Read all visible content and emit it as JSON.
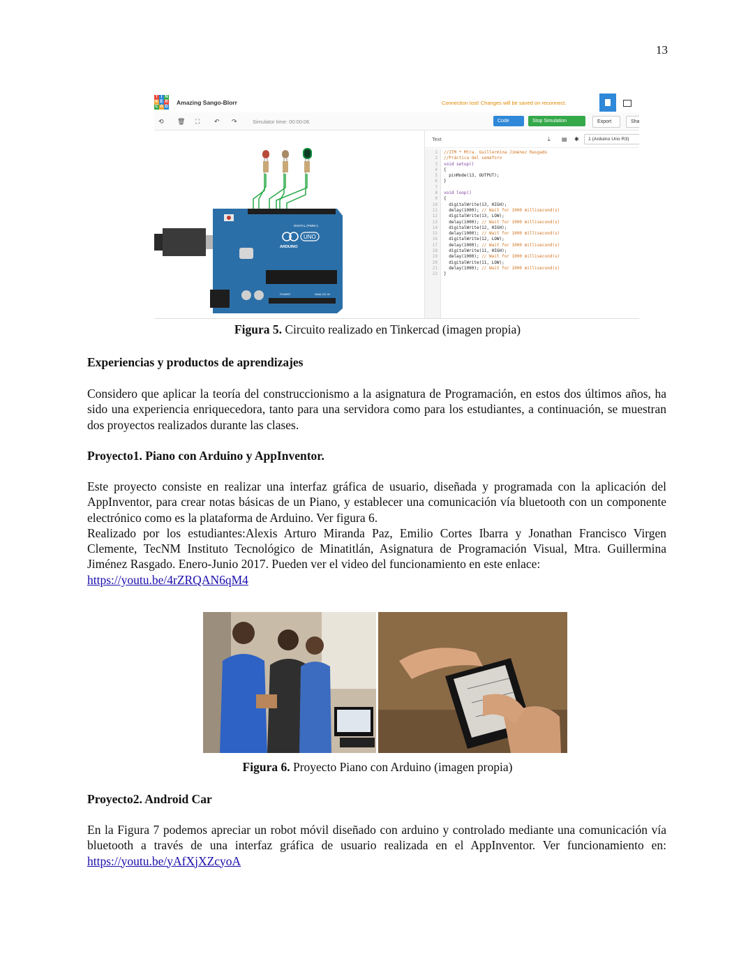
{
  "page_number": "13",
  "figure5": {
    "app_title": "Amazing Sango-Blorr",
    "logo_letters": [
      "T",
      "I",
      "N",
      "K",
      "E",
      "R",
      "C",
      "A",
      "D"
    ],
    "warning": "Connection lost! Changes will be saved on reconnect.",
    "simulator_time": "Simulator time: 00:00:06",
    "buttons": {
      "code": "Code",
      "stop": "Stop Simulation",
      "export": "Export",
      "share": "Sha"
    },
    "panel_label": "Text",
    "board_select": "1 (Arduino Uno R3)",
    "board_labels": {
      "brand": "ARDUINO",
      "model": "UNO",
      "digital": "DIGITAL (PWM~)",
      "power": "POWER",
      "analog": "ANALOG IN"
    },
    "code_lines": [
      {
        "n": "1",
        "t": "//ITM * Mtra. Guillermina Jiménez Rasgado",
        "k": "com"
      },
      {
        "n": "2",
        "t": "//Práctica del semáforo",
        "k": "com"
      },
      {
        "n": "3",
        "t": "void setup()",
        "k": "kw"
      },
      {
        "n": "4",
        "t": "{",
        "k": "txt"
      },
      {
        "n": "5",
        "t": "  pinMode(13, OUTPUT);",
        "k": "txt"
      },
      {
        "n": "6",
        "t": "}",
        "k": "txt"
      },
      {
        "n": "7",
        "t": "",
        "k": "txt"
      },
      {
        "n": "8",
        "t": "void loop()",
        "k": "kw"
      },
      {
        "n": "9",
        "t": "{",
        "k": "txt"
      },
      {
        "n": "10",
        "t": "  digitalWrite(13, HIGH);",
        "k": "txt"
      },
      {
        "n": "11",
        "t": "  delay(1000); // Wait for 1000 millisecond(s)",
        "k": "mix"
      },
      {
        "n": "12",
        "t": "  digitalWrite(13, LOW);",
        "k": "txt"
      },
      {
        "n": "13",
        "t": "  delay(1000); // Wait for 1000 millisecond(s)",
        "k": "mix"
      },
      {
        "n": "14",
        "t": "  digitalWrite(12, HIGH);",
        "k": "txt"
      },
      {
        "n": "15",
        "t": "  delay(1000); // Wait for 1000 millisecond(s)",
        "k": "mix"
      },
      {
        "n": "16",
        "t": "  digitalWrite(12, LOW);",
        "k": "txt"
      },
      {
        "n": "17",
        "t": "  delay(1000); // Wait for 1000 millisecond(s)",
        "k": "mix"
      },
      {
        "n": "18",
        "t": "  digitalWrite(11, HIGH);",
        "k": "txt"
      },
      {
        "n": "19",
        "t": "  delay(1000); // Wait for 1000 millisecond(s)",
        "k": "mix"
      },
      {
        "n": "20",
        "t": "  digitalWrite(11, LOW);",
        "k": "txt"
      },
      {
        "n": "21",
        "t": "  delay(1000); // Wait for 1000 millisecond(s)",
        "k": "mix"
      },
      {
        "n": "22",
        "t": "}",
        "k": "txt"
      }
    ],
    "caption_bold": "Figura 5.",
    "caption_text": " Circuito realizado en Tinkercad (imagen propia)"
  },
  "section1": {
    "heading": "Experiencias y productos de aprendizajes",
    "paragraph": "Considero que aplicar la teoría del construccionismo a la asignatura de Programación, en estos dos últimos años, ha sido una experiencia enriquecedora, tanto para una servidora como para los estudiantes, a continuación, se muestran dos proyectos realizados durante las clases."
  },
  "project1": {
    "heading": "Proyecto1. Piano con Arduino y AppInventor.",
    "paragraph1": "Este proyecto consiste en realizar una interfaz gráfica de usuario, diseñada y programada con la aplicación del AppInventor, para crear notas básicas de un Piano, y establecer una comunicación vía bluetooth con un componente electrónico como es la plataforma de Arduino.  Ver figura 6.",
    "paragraph2": "Realizado por los estudiantes:Alexis Arturo Miranda Paz, Emilio Cortes Ibarra y Jonathan Francisco Virgen Clemente, TecNM Instituto Tecnológico de Minatitlán, Asignatura de Programación Visual, Mtra. Guillermina Jiménez Rasgado. Enero-Junio 2017. Pueden ver el video del funcionamiento en este enlace:",
    "link": "https://youtu.be/4rZRQAN6qM4"
  },
  "figure6": {
    "caption_bold": "Figura 6.",
    "caption_text": " Proyecto Piano con Arduino (imagen propia)"
  },
  "project2": {
    "heading": "Proyecto2. Android Car",
    "paragraph": "En la Figura 7 podemos apreciar un robot móvil diseñado con arduino y controlado mediante una comunicación vía bluetooth a través de una interfaz gráfica de usuario realizada en el AppInventor. Ver funcionamiento en:",
    "link": "https://youtu.be/yAfXjXZcyoA"
  },
  "colors": {
    "link": "#1a0dab",
    "tinkercad_blue": "#2f88d8",
    "tinkercad_green": "#35a84a",
    "board": "#2b6fa8"
  }
}
